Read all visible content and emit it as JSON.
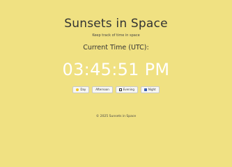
{
  "header": {
    "title": "Sunsets in Space",
    "subtitle": "Keep track of time in space"
  },
  "clock": {
    "heading": "Current Time (UTC):",
    "time": "03:45:51 PM"
  },
  "time_buttons": [
    {
      "label": "Day",
      "icon": "sun-icon"
    },
    {
      "label": "Afternoon",
      "icon": "afternoon-icon"
    },
    {
      "label": "Evening",
      "icon": "evening-icon"
    },
    {
      "label": "Night",
      "icon": "night-icon"
    }
  ],
  "footer": {
    "text": "© 2025 Sunsets in Space"
  },
  "colors": {
    "background": "#f0e182",
    "text": "#333333",
    "clock_text": "#ffffff"
  }
}
